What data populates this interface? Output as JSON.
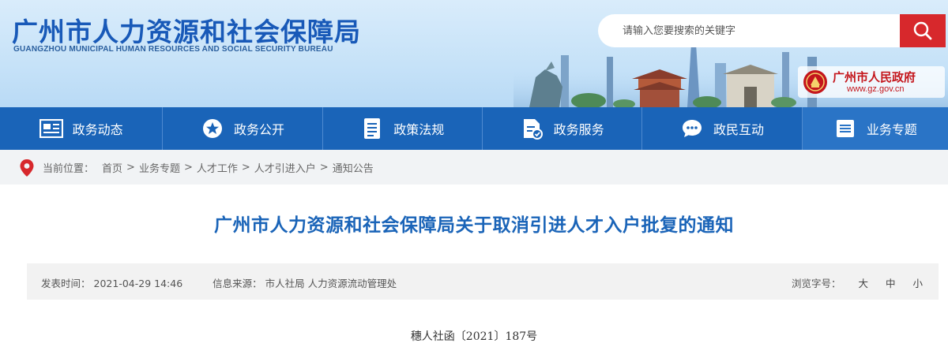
{
  "header": {
    "title": "广州市人力资源和社会保障局",
    "subtitle": "GUANGZHOU MUNICIPAL HUMAN RESOURCES AND SOCIAL SECURITY BUREAU",
    "search_placeholder": "请输入您要搜索的关键字",
    "gov_name": "广州市人民政府",
    "gov_url": "www.gz.gov.cn"
  },
  "nav": {
    "items": [
      {
        "label": "政务动态",
        "icon": "news-icon"
      },
      {
        "label": "政务公开",
        "icon": "star-icon"
      },
      {
        "label": "政策法规",
        "icon": "document-icon"
      },
      {
        "label": "政务服务",
        "icon": "service-icon"
      },
      {
        "label": "政民互动",
        "icon": "chat-icon"
      },
      {
        "label": "业务专题",
        "icon": "list-icon"
      }
    ]
  },
  "breadcrumb": {
    "label": "当前位置：",
    "items": [
      "首页",
      "业务专题",
      "人才工作",
      "人才引进入户",
      "通知公告"
    ],
    "separator": ">"
  },
  "article": {
    "title": "广州市人力资源和社会保障局关于取消引进人才入户批复的通知",
    "publish_label": "发表时间：",
    "publish_time": "2021-04-29 14:46",
    "source_label": "信息来源：",
    "source": "市人社局 人力资源流动管理处",
    "font_size_label": "浏览字号：",
    "font_sizes": [
      "大",
      "中",
      "小"
    ],
    "doc_number": "穗人社函〔2021〕187号"
  },
  "colors": {
    "brand_blue": "#1a64b8",
    "title_blue": "#1859b8",
    "search_red": "#d7282c",
    "gov_red": "#c4161c"
  }
}
